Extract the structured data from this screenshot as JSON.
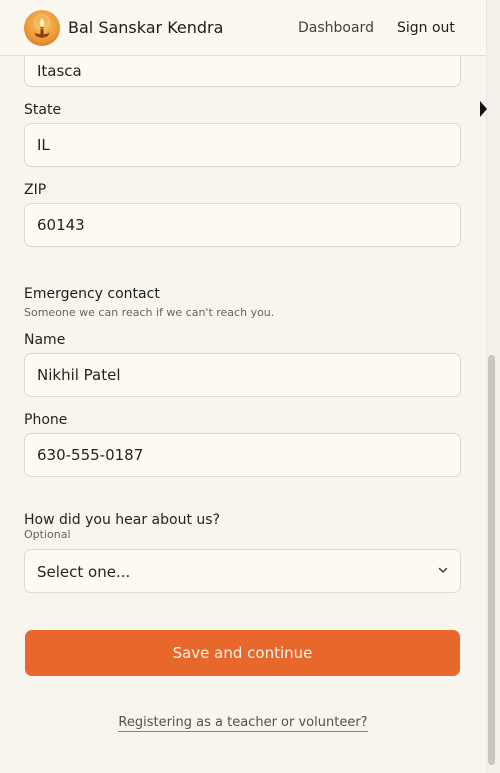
{
  "header": {
    "brand": "Bal Sanskar Kendra",
    "nav": {
      "dashboard": "Dashboard",
      "sign_out": "Sign out"
    }
  },
  "form": {
    "city": {
      "value": "Itasca"
    },
    "state": {
      "label": "State",
      "value": "IL"
    },
    "zip": {
      "label": "ZIP",
      "value": "60143"
    },
    "emergency": {
      "title": "Emergency contact",
      "subtitle": "Someone we can reach if we can't reach you.",
      "name": {
        "label": "Name",
        "value": "Nikhil Patel"
      },
      "phone": {
        "label": "Phone",
        "value": "630-555-0187"
      }
    },
    "referral": {
      "label": "How did you hear about us?",
      "optional": "Optional",
      "selected": "Select one..."
    },
    "submit": "Save and continue",
    "alt_link": "Registering as a teacher or volunteer?"
  },
  "colors": {
    "accent": "#e8672a",
    "background": "#f8f5ef"
  },
  "icons": {
    "logo": "diya-lamp-icon",
    "select": "chevron-down-icon"
  }
}
